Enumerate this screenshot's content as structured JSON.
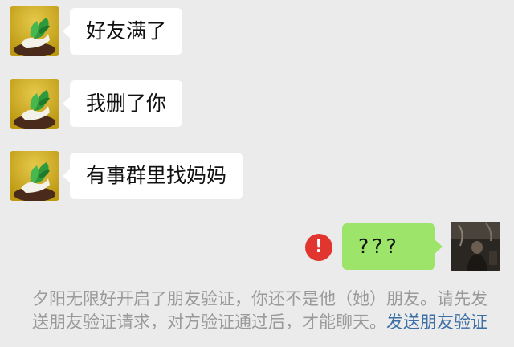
{
  "messages": [
    {
      "text": "好友满了"
    },
    {
      "text": "我删了你"
    },
    {
      "text": "有事群里找妈妈"
    }
  ],
  "sent_message": {
    "text": "???",
    "status_icon": "exclamation-icon"
  },
  "notice": {
    "text": "夕阳无限好开启了朋友验证，你还不是他（她）朋友。请先发送朋友验证请求，对方验证通过后，才能聊天。",
    "link": "发送朋友验证"
  },
  "colors": {
    "background": "#ebebeb",
    "incoming_bubble": "#ffffff",
    "outgoing_bubble": "#9de46a",
    "error_badge": "#e1362f",
    "notice_text": "#9a9a9a",
    "link": "#3c6ea6"
  }
}
